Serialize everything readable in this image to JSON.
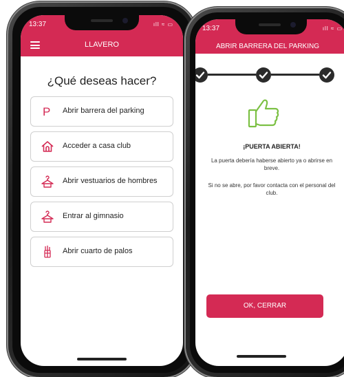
{
  "colors": {
    "accent": "#d42a54",
    "success": "#7bc043",
    "dark": "#2b2b2b"
  },
  "left_phone": {
    "status": {
      "time": "13:37",
      "icons": "ıll ≈ ▭"
    },
    "header": {
      "title": "LLAVERO",
      "menu_icon": "hamburger-menu-icon"
    },
    "question": "¿Qué deseas hacer?",
    "options": [
      {
        "label": "Abrir barrera del parking",
        "icon": "parking-icon"
      },
      {
        "label": "Acceder a casa club",
        "icon": "house-icon"
      },
      {
        "label": "Abrir vestuarios de hombres",
        "icon": "hanger-icon"
      },
      {
        "label": "Entrar al gimnasio",
        "icon": "hanger-icon"
      },
      {
        "label": "Abrir cuarto de palos",
        "icon": "golf-bag-icon"
      }
    ]
  },
  "right_phone": {
    "status": {
      "time": "13:37",
      "icons": "ıll ≈ ▭"
    },
    "header": {
      "title": "ABRIR BARRERA DEL PARKING"
    },
    "steps": {
      "total": 3,
      "completed": 3,
      "icon": "check-icon"
    },
    "result_icon": "thumbs-up-icon",
    "message_title": "¡PUERTA ABIERTA!",
    "message_line1": "La puerta debería haberse abierto ya o abrirse en breve.",
    "message_line2": "Si no se abre, por favor contacta con el personal del club.",
    "button_label": "OK, CERRAR"
  }
}
